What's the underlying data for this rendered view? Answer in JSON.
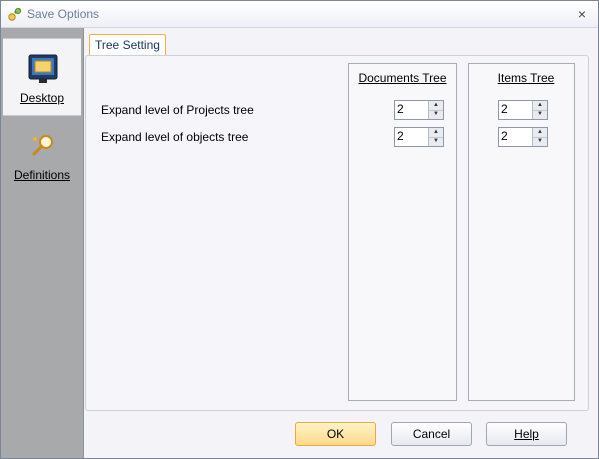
{
  "window": {
    "title": "Save Options",
    "close_glyph": "×",
    "app_icon": "settings-key-icon"
  },
  "sidebar": {
    "items": [
      {
        "label": "Desktop",
        "icon": "monitor-icon",
        "active": true
      },
      {
        "label": "Definitions",
        "icon": "magnifier-icon",
        "active": false
      }
    ]
  },
  "tabs": [
    {
      "label": "Tree Setting",
      "active": true
    }
  ],
  "tree_setting": {
    "columns": [
      "Documents Tree",
      "Items Tree"
    ],
    "rows": [
      {
        "label": "Expand level of Projects tree",
        "documents_value": "2",
        "items_value": "2"
      },
      {
        "label": "Expand level of objects tree",
        "documents_value": "2",
        "items_value": "2"
      }
    ]
  },
  "buttons": {
    "ok": "OK",
    "cancel": "Cancel",
    "help": "Help"
  },
  "colors": {
    "sidebar_bg": "#a7a9ab",
    "title_text": "#6d7f9a",
    "tab_border": "#f0b048",
    "primary_button": "#ffd98a"
  }
}
